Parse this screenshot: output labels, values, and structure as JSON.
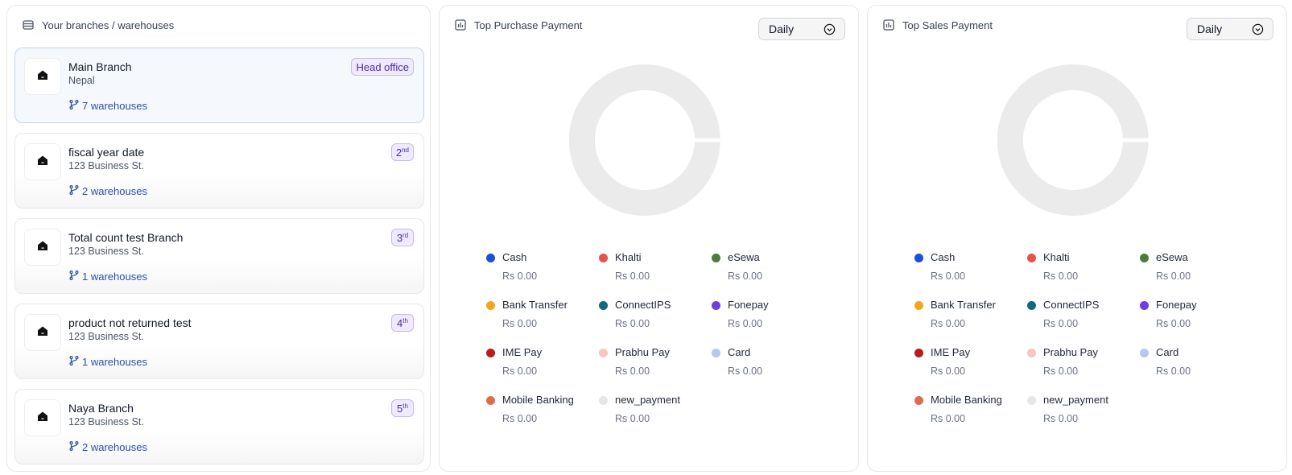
{
  "branches_panel": {
    "title": "Your branches / warehouses",
    "branches": [
      {
        "name": "Main Branch",
        "sub": "Nepal",
        "warehouses": "7 warehouses",
        "badge": "Head office",
        "rank_num": "",
        "rank_suffix": ""
      },
      {
        "name": "fiscal year date",
        "sub": "123 Business St.",
        "warehouses": "2 warehouses",
        "badge": "",
        "rank_num": "2",
        "rank_suffix": "nd"
      },
      {
        "name": "Total count test Branch",
        "sub": "123 Business St.",
        "warehouses": "1 warehouses",
        "badge": "",
        "rank_num": "3",
        "rank_suffix": "rd"
      },
      {
        "name": "product not returned test",
        "sub": "123 Business St.",
        "warehouses": "1 warehouses",
        "badge": "",
        "rank_num": "4",
        "rank_suffix": "th"
      },
      {
        "name": "Naya Branch",
        "sub": "123 Business St.",
        "warehouses": "2 warehouses",
        "badge": "",
        "rank_num": "5",
        "rank_suffix": "th"
      }
    ]
  },
  "purchase_panel": {
    "title": "Top Purchase Payment",
    "period": "Daily",
    "legend": [
      {
        "label": "Cash",
        "value": "Rs 0.00",
        "color": "#1d4ed8"
      },
      {
        "label": "Khalti",
        "value": "Rs 0.00",
        "color": "#e5534b"
      },
      {
        "label": "eSewa",
        "value": "Rs 0.00",
        "color": "#4d7c3a"
      },
      {
        "label": "Bank Transfer",
        "value": "Rs 0.00",
        "color": "#f4a51c"
      },
      {
        "label": "ConnectIPS",
        "value": "Rs 0.00",
        "color": "#0e6b7e"
      },
      {
        "label": "Fonepay",
        "value": "Rs 0.00",
        "color": "#6d3fe0"
      },
      {
        "label": "IME Pay",
        "value": "Rs 0.00",
        "color": "#b91c1c"
      },
      {
        "label": "Prabhu Pay",
        "value": "Rs 0.00",
        "color": "#f7c6c3"
      },
      {
        "label": "Card",
        "value": "Rs 0.00",
        "color": "#b7c8ee"
      },
      {
        "label": "Mobile Banking",
        "value": "Rs 0.00",
        "color": "#e06b4f"
      },
      {
        "label": "new_payment",
        "value": "Rs 0.00",
        "color": "#e6e6e6"
      }
    ]
  },
  "sales_panel": {
    "title": "Top Sales Payment",
    "period": "Daily",
    "legend": [
      {
        "label": "Cash",
        "value": "Rs 0.00",
        "color": "#1d4ed8"
      },
      {
        "label": "Khalti",
        "value": "Rs 0.00",
        "color": "#e5534b"
      },
      {
        "label": "eSewa",
        "value": "Rs 0.00",
        "color": "#4d7c3a"
      },
      {
        "label": "Bank Transfer",
        "value": "Rs 0.00",
        "color": "#f4a51c"
      },
      {
        "label": "ConnectIPS",
        "value": "Rs 0.00",
        "color": "#0e6b7e"
      },
      {
        "label": "Fonepay",
        "value": "Rs 0.00",
        "color": "#6d3fe0"
      },
      {
        "label": "IME Pay",
        "value": "Rs 0.00",
        "color": "#b91c1c"
      },
      {
        "label": "Prabhu Pay",
        "value": "Rs 0.00",
        "color": "#f7c6c3"
      },
      {
        "label": "Card",
        "value": "Rs 0.00",
        "color": "#b7c8ee"
      },
      {
        "label": "Mobile Banking",
        "value": "Rs 0.00",
        "color": "#e06b4f"
      },
      {
        "label": "new_payment",
        "value": "Rs 0.00",
        "color": "#e6e6e6"
      }
    ]
  },
  "colors": {
    "donut_empty": "#ebebeb",
    "badge_border": "#c7b8f0",
    "badge_bg": "#efeafd",
    "link": "#2b4fa7",
    "active_card_bg": "#f5f8fd"
  }
}
